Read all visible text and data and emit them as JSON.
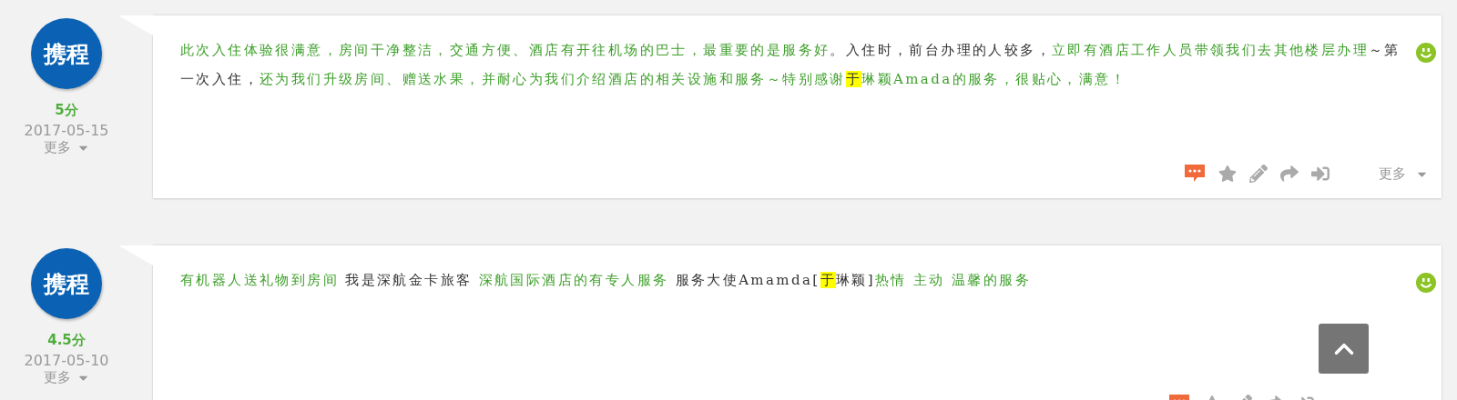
{
  "reviews": [
    {
      "logo_text": "携程",
      "score": "5分",
      "date": "2017-05-15",
      "more": "更多",
      "action_more": "更多",
      "segments": [
        {
          "text": "此次入住体验很满意，房间干净整洁，交通方便、酒店有开往机场的巴士，最重要的是服务好",
          "kind": "positive",
          "highlighted": false
        },
        {
          "text": "。入住时，前台办理的人较多，",
          "kind": "neutral",
          "highlighted": false
        },
        {
          "text": "立即有酒店工作人员带领我们去其他楼层办理",
          "kind": "positive",
          "highlighted": false
        },
        {
          "text": "～第一次入住，",
          "kind": "neutral",
          "highlighted": false
        },
        {
          "text": "还为我们升级房间、赠送水果，并耐心为我们介绍酒店的相关设施和服务～特别感谢",
          "kind": "positive",
          "highlighted": false
        },
        {
          "text": "于",
          "kind": "neutral",
          "highlighted": true
        },
        {
          "text": "琳颖Amada的服务，很贴心，满意！",
          "kind": "positive",
          "highlighted": false
        }
      ]
    },
    {
      "logo_text": "携程",
      "score": "4.5分",
      "date": "2017-05-10",
      "more": "更多",
      "segments": [
        {
          "text": "有机器人送礼物到房间",
          "kind": "positive",
          "highlighted": false
        },
        {
          "text": " 我是深航金卡旅客 ",
          "kind": "neutral",
          "highlighted": false
        },
        {
          "text": "深航国际酒店的有专人服务",
          "kind": "positive",
          "highlighted": false
        },
        {
          "text": " 服务大使Amamda[",
          "kind": "neutral",
          "highlighted": false
        },
        {
          "text": "于",
          "kind": "neutral",
          "highlighted": true
        },
        {
          "text": "琳颖]",
          "kind": "neutral",
          "highlighted": false
        },
        {
          "text": "热情 主动 温馨的服务",
          "kind": "positive",
          "highlighted": false
        }
      ]
    }
  ]
}
